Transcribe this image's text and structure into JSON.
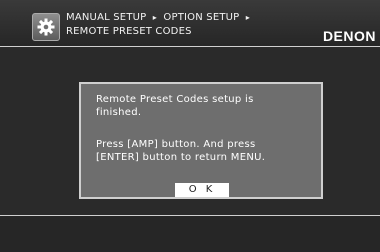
{
  "header": {
    "breadcrumb": [
      "MANUAL SETUP",
      "OPTION SETUP",
      "REMOTE PRESET CODES"
    ],
    "separator": "▸",
    "brand": "DENON",
    "icon": "gear-icon"
  },
  "dialog": {
    "message_line1": "Remote Preset Codes setup is\nfinished.",
    "message_line2": "Press [AMP] button. And press\n[ENTER] button to return MENU.",
    "ok_label": "O K"
  },
  "colors": {
    "background": "#2a2a2a",
    "dialog_bg": "#6e6e6e",
    "border": "#cfcfcf"
  }
}
